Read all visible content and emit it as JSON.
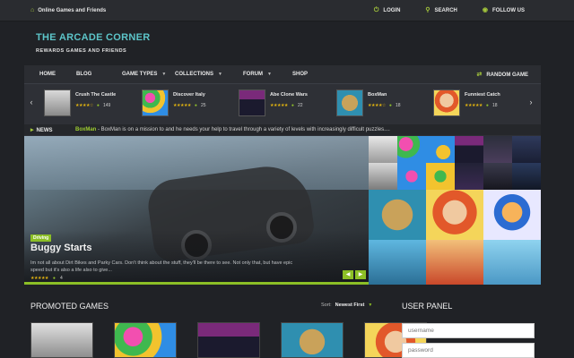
{
  "topbar": {
    "site_name": "Online Games and Friends",
    "links": [
      {
        "label": "LOGIN",
        "icon": "power-icon"
      },
      {
        "label": "SEARCH",
        "icon": "search-icon"
      },
      {
        "label": "FOLLOW US",
        "icon": "rss-icon"
      }
    ]
  },
  "brand": {
    "logo": "THE ARCADE CORNER",
    "tagline": "REWARDS GAMES AND FRIENDS",
    "accent": "#5cc5c9",
    "green": "#8cbf26"
  },
  "nav": {
    "items": [
      {
        "label": "HOME"
      },
      {
        "label": "BLOG"
      },
      {
        "label": "GAME TYPES",
        "dropdown": true
      },
      {
        "label": "COLLECTIONS",
        "dropdown": true
      },
      {
        "label": "FORUM",
        "dropdown": true
      },
      {
        "label": "SHOP"
      }
    ],
    "random": "RANDOM GAME"
  },
  "carousel": {
    "games": [
      {
        "title": "Crush The Castle",
        "rating": 4,
        "plays": "149"
      },
      {
        "title": "Discover Italy",
        "rating": 5,
        "plays": "25"
      },
      {
        "title": "Abe Clone Wars",
        "rating": 5,
        "plays": "22"
      },
      {
        "title": "BoxMan",
        "rating": 4,
        "plays": "18"
      },
      {
        "title": "Funniest Catch",
        "rating": 5,
        "plays": "18"
      }
    ]
  },
  "news": {
    "label": "NEWS",
    "highlight": "BoxMan",
    "text": " - BoxMan is on a mission to and he needs your help to travel through a variety of levels with increasingly difficult puzzles...."
  },
  "hero": {
    "category": "Driving",
    "title": "Buggy Starts",
    "description": "Im not all about Dirt Bikes and Parky Cars. Don't think about the stuff, they'll be there to see. Not only that, but have epic speed but it's also a life also to give...",
    "plays": "4",
    "prev": "◀",
    "next": "▶"
  },
  "promoted": {
    "heading": "PROMOTED GAMES",
    "sort_label": "Sort:",
    "sort_value": "Newest First"
  },
  "user_panel": {
    "heading": "USER PANEL",
    "username_placeholder": "username",
    "password_placeholder": "password"
  }
}
